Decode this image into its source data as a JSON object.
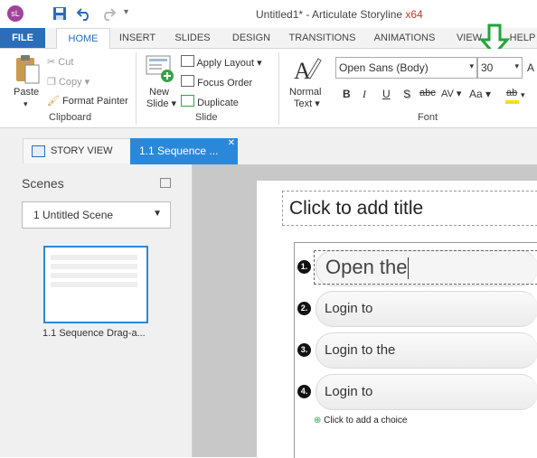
{
  "app": {
    "logo_text": "sL",
    "window_title": "Untitled1* - Articulate Storyline",
    "arch": "x64"
  },
  "ribbon_tabs": [
    "FILE",
    "HOME",
    "INSERT",
    "SLIDES",
    "DESIGN",
    "TRANSITIONS",
    "ANIMATIONS",
    "VIEW",
    "HELP"
  ],
  "clipboard": {
    "paste": "Paste",
    "cut": "Cut",
    "copy": "Copy",
    "format_painter": "Format Painter",
    "group_label": "Clipboard"
  },
  "slide_group": {
    "new_slide_line1": "New",
    "new_slide_line2": "Slide",
    "apply_layout": "Apply Layout",
    "focus_order": "Focus Order",
    "duplicate": "Duplicate",
    "group_label": "Slide"
  },
  "text_group": {
    "normal_text_line1": "Normal",
    "normal_text_line2": "Text"
  },
  "font": {
    "family": "Open Sans (Body)",
    "size": "30",
    "group_label": "Font",
    "bold": "B",
    "italic": "I",
    "underline": "U",
    "shadow": "S",
    "strike": "abc",
    "spacing": "AV",
    "case": "Aa",
    "highlight": "ab",
    "accent_colors": {
      "arrow": "#22a33a",
      "highlight": "#f1e300",
      "brand": "#2b6db9"
    }
  },
  "workspace_tabs": {
    "story_view": "STORY VIEW",
    "slide_tab": "1.1 Sequence ..."
  },
  "scenes": {
    "title": "Scenes",
    "dropdown_value": "1 Untitled Scene",
    "thumbnail_caption": "1.1 Sequence Drag-a..."
  },
  "slide": {
    "title_placeholder": "Click to add title",
    "choices": [
      {
        "number": "1.",
        "text": "Open the"
      },
      {
        "number": "2.",
        "text": "Login to"
      },
      {
        "number": "3.",
        "text": "Login to the"
      },
      {
        "number": "4.",
        "text": "Login to"
      }
    ],
    "add_choice": "Click to add a choice"
  }
}
